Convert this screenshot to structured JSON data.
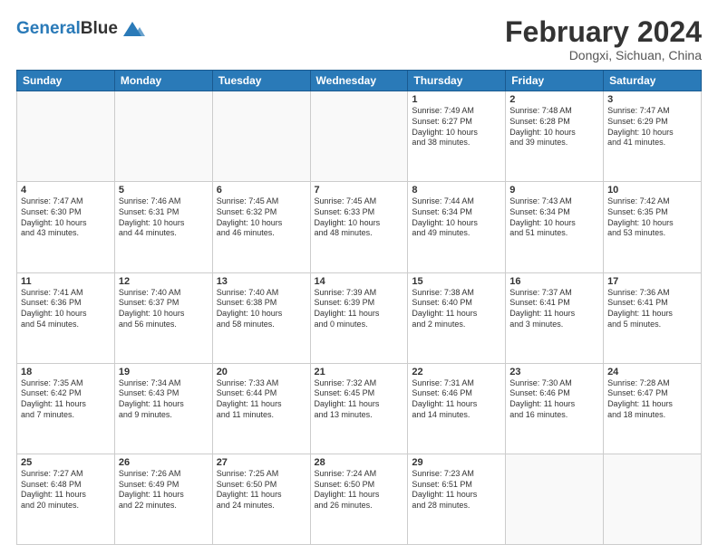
{
  "header": {
    "logo_line1": "General",
    "logo_line2": "Blue",
    "main_title": "February 2024",
    "subtitle": "Dongxi, Sichuan, China"
  },
  "days_of_week": [
    "Sunday",
    "Monday",
    "Tuesday",
    "Wednesday",
    "Thursday",
    "Friday",
    "Saturday"
  ],
  "weeks": [
    [
      {
        "day": "",
        "info": ""
      },
      {
        "day": "",
        "info": ""
      },
      {
        "day": "",
        "info": ""
      },
      {
        "day": "",
        "info": ""
      },
      {
        "day": "1",
        "info": "Sunrise: 7:49 AM\nSunset: 6:27 PM\nDaylight: 10 hours\nand 38 minutes."
      },
      {
        "day": "2",
        "info": "Sunrise: 7:48 AM\nSunset: 6:28 PM\nDaylight: 10 hours\nand 39 minutes."
      },
      {
        "day": "3",
        "info": "Sunrise: 7:47 AM\nSunset: 6:29 PM\nDaylight: 10 hours\nand 41 minutes."
      }
    ],
    [
      {
        "day": "4",
        "info": "Sunrise: 7:47 AM\nSunset: 6:30 PM\nDaylight: 10 hours\nand 43 minutes."
      },
      {
        "day": "5",
        "info": "Sunrise: 7:46 AM\nSunset: 6:31 PM\nDaylight: 10 hours\nand 44 minutes."
      },
      {
        "day": "6",
        "info": "Sunrise: 7:45 AM\nSunset: 6:32 PM\nDaylight: 10 hours\nand 46 minutes."
      },
      {
        "day": "7",
        "info": "Sunrise: 7:45 AM\nSunset: 6:33 PM\nDaylight: 10 hours\nand 48 minutes."
      },
      {
        "day": "8",
        "info": "Sunrise: 7:44 AM\nSunset: 6:34 PM\nDaylight: 10 hours\nand 49 minutes."
      },
      {
        "day": "9",
        "info": "Sunrise: 7:43 AM\nSunset: 6:34 PM\nDaylight: 10 hours\nand 51 minutes."
      },
      {
        "day": "10",
        "info": "Sunrise: 7:42 AM\nSunset: 6:35 PM\nDaylight: 10 hours\nand 53 minutes."
      }
    ],
    [
      {
        "day": "11",
        "info": "Sunrise: 7:41 AM\nSunset: 6:36 PM\nDaylight: 10 hours\nand 54 minutes."
      },
      {
        "day": "12",
        "info": "Sunrise: 7:40 AM\nSunset: 6:37 PM\nDaylight: 10 hours\nand 56 minutes."
      },
      {
        "day": "13",
        "info": "Sunrise: 7:40 AM\nSunset: 6:38 PM\nDaylight: 10 hours\nand 58 minutes."
      },
      {
        "day": "14",
        "info": "Sunrise: 7:39 AM\nSunset: 6:39 PM\nDaylight: 11 hours\nand 0 minutes."
      },
      {
        "day": "15",
        "info": "Sunrise: 7:38 AM\nSunset: 6:40 PM\nDaylight: 11 hours\nand 2 minutes."
      },
      {
        "day": "16",
        "info": "Sunrise: 7:37 AM\nSunset: 6:41 PM\nDaylight: 11 hours\nand 3 minutes."
      },
      {
        "day": "17",
        "info": "Sunrise: 7:36 AM\nSunset: 6:41 PM\nDaylight: 11 hours\nand 5 minutes."
      }
    ],
    [
      {
        "day": "18",
        "info": "Sunrise: 7:35 AM\nSunset: 6:42 PM\nDaylight: 11 hours\nand 7 minutes."
      },
      {
        "day": "19",
        "info": "Sunrise: 7:34 AM\nSunset: 6:43 PM\nDaylight: 11 hours\nand 9 minutes."
      },
      {
        "day": "20",
        "info": "Sunrise: 7:33 AM\nSunset: 6:44 PM\nDaylight: 11 hours\nand 11 minutes."
      },
      {
        "day": "21",
        "info": "Sunrise: 7:32 AM\nSunset: 6:45 PM\nDaylight: 11 hours\nand 13 minutes."
      },
      {
        "day": "22",
        "info": "Sunrise: 7:31 AM\nSunset: 6:46 PM\nDaylight: 11 hours\nand 14 minutes."
      },
      {
        "day": "23",
        "info": "Sunrise: 7:30 AM\nSunset: 6:46 PM\nDaylight: 11 hours\nand 16 minutes."
      },
      {
        "day": "24",
        "info": "Sunrise: 7:28 AM\nSunset: 6:47 PM\nDaylight: 11 hours\nand 18 minutes."
      }
    ],
    [
      {
        "day": "25",
        "info": "Sunrise: 7:27 AM\nSunset: 6:48 PM\nDaylight: 11 hours\nand 20 minutes."
      },
      {
        "day": "26",
        "info": "Sunrise: 7:26 AM\nSunset: 6:49 PM\nDaylight: 11 hours\nand 22 minutes."
      },
      {
        "day": "27",
        "info": "Sunrise: 7:25 AM\nSunset: 6:50 PM\nDaylight: 11 hours\nand 24 minutes."
      },
      {
        "day": "28",
        "info": "Sunrise: 7:24 AM\nSunset: 6:50 PM\nDaylight: 11 hours\nand 26 minutes."
      },
      {
        "day": "29",
        "info": "Sunrise: 7:23 AM\nSunset: 6:51 PM\nDaylight: 11 hours\nand 28 minutes."
      },
      {
        "day": "",
        "info": ""
      },
      {
        "day": "",
        "info": ""
      }
    ]
  ]
}
